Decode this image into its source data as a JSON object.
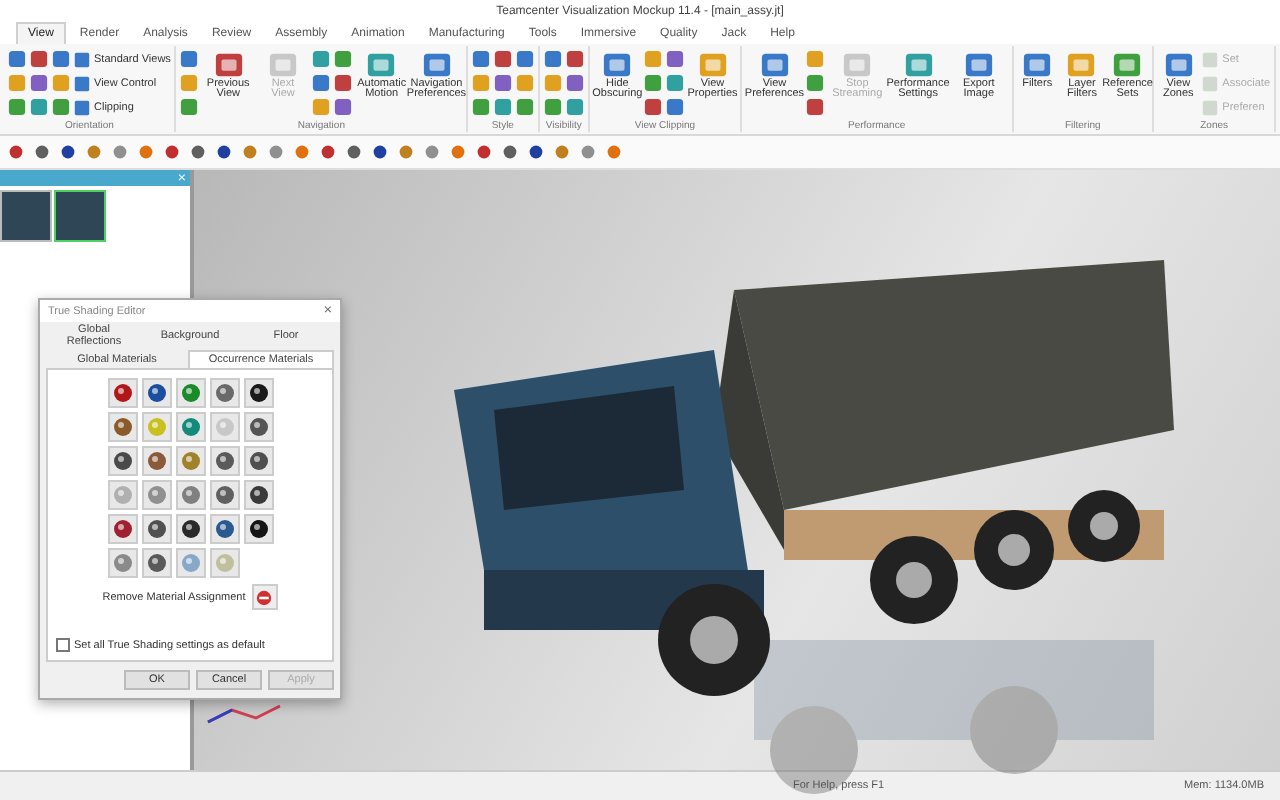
{
  "window": {
    "title": "Teamcenter Visualization Mockup 11.4 - [main_assy.jt]"
  },
  "tabs": [
    {
      "label": "View",
      "selected": true
    },
    {
      "label": "Render",
      "selected": false
    },
    {
      "label": "Analysis",
      "selected": false
    },
    {
      "label": "Review",
      "selected": false
    },
    {
      "label": "Assembly",
      "selected": false
    },
    {
      "label": "Animation",
      "selected": false
    },
    {
      "label": "Manufacturing",
      "selected": false
    },
    {
      "label": "Tools",
      "selected": false
    },
    {
      "label": "Immersive",
      "selected": false
    },
    {
      "label": "Quality",
      "selected": false
    },
    {
      "label": "Jack",
      "selected": false
    },
    {
      "label": "Help",
      "selected": false
    }
  ],
  "ribbon": {
    "groups": [
      {
        "label": "Orientation",
        "buttons": [
          {
            "kind": "icon",
            "disabled": false
          },
          {
            "kind": "icon",
            "disabled": false
          },
          {
            "kind": "icon",
            "disabled": false
          },
          {
            "kind": "icon",
            "disabled": false
          },
          {
            "kind": "icon",
            "disabled": false
          },
          {
            "kind": "icon",
            "disabled": false
          },
          {
            "kind": "icon",
            "disabled": false
          },
          {
            "kind": "icon",
            "disabled": false
          },
          {
            "kind": "icon",
            "disabled": false
          },
          {
            "kind": "small",
            "label": "Standard Views",
            "disabled": false
          },
          {
            "kind": "small",
            "label": "View Control",
            "disabled": false
          },
          {
            "kind": "small",
            "label": "Clipping",
            "disabled": false
          }
        ]
      },
      {
        "label": "Navigation",
        "buttons": [
          {
            "kind": "icon",
            "disabled": false
          },
          {
            "kind": "icon",
            "disabled": false
          },
          {
            "kind": "icon",
            "disabled": false
          },
          {
            "kind": "large",
            "label": "Previous View",
            "disabled": false
          },
          {
            "kind": "large",
            "label": "Next View",
            "disabled": true
          },
          {
            "kind": "icon",
            "disabled": false
          },
          {
            "kind": "icon",
            "disabled": false
          },
          {
            "kind": "icon",
            "disabled": false
          },
          {
            "kind": "icon",
            "disabled": false
          },
          {
            "kind": "icon",
            "disabled": false
          },
          {
            "kind": "icon",
            "disabled": false
          },
          {
            "kind": "large",
            "label": "Automatic Motion",
            "disabled": false
          },
          {
            "kind": "large",
            "label": "Navigation Preferences",
            "disabled": false
          }
        ]
      },
      {
        "label": "Style",
        "buttons": [
          {
            "kind": "icon",
            "disabled": false
          },
          {
            "kind": "icon",
            "disabled": false
          },
          {
            "kind": "icon",
            "disabled": false
          },
          {
            "kind": "icon",
            "disabled": false
          },
          {
            "kind": "icon",
            "disabled": false
          },
          {
            "kind": "icon",
            "disabled": false
          },
          {
            "kind": "icon",
            "disabled": false
          },
          {
            "kind": "icon",
            "disabled": false
          },
          {
            "kind": "icon",
            "disabled": false
          }
        ]
      },
      {
        "label": "Visibility",
        "buttons": [
          {
            "kind": "icon",
            "disabled": false
          },
          {
            "kind": "icon",
            "disabled": false
          },
          {
            "kind": "icon",
            "disabled": false
          },
          {
            "kind": "icon",
            "disabled": false
          },
          {
            "kind": "icon",
            "disabled": false
          },
          {
            "kind": "icon",
            "disabled": false
          }
        ]
      },
      {
        "label": "View Clipping",
        "buttons": [
          {
            "kind": "large",
            "label": "Hide Obscuring",
            "disabled": false
          },
          {
            "kind": "icon",
            "disabled": false
          },
          {
            "kind": "icon",
            "disabled": false
          },
          {
            "kind": "icon",
            "disabled": false
          },
          {
            "kind": "icon",
            "disabled": false
          },
          {
            "kind": "icon",
            "disabled": false
          },
          {
            "kind": "icon",
            "disabled": false
          },
          {
            "kind": "large",
            "label": "View Properties",
            "disabled": false
          }
        ]
      },
      {
        "label": "Performance",
        "buttons": [
          {
            "kind": "large",
            "label": "View Preferences",
            "disabled": false
          },
          {
            "kind": "icon",
            "disabled": false
          },
          {
            "kind": "icon",
            "disabled": false
          },
          {
            "kind": "icon",
            "disabled": false
          },
          {
            "kind": "large",
            "label": "Stop Streaming",
            "disabled": true
          },
          {
            "kind": "large",
            "label": "Performance Settings",
            "disabled": false
          },
          {
            "kind": "large",
            "label": "Export Image",
            "disabled": false
          }
        ]
      },
      {
        "label": "Filtering",
        "buttons": [
          {
            "kind": "large",
            "label": "Filters",
            "disabled": false
          },
          {
            "kind": "large",
            "label": "Layer Filters",
            "disabled": false
          },
          {
            "kind": "large",
            "label": "Reference Sets",
            "disabled": false
          }
        ]
      },
      {
        "label": "Zones",
        "buttons": [
          {
            "kind": "large",
            "label": "View Zones",
            "disabled": false
          },
          {
            "kind": "small",
            "label": "Set",
            "disabled": true
          },
          {
            "kind": "small",
            "label": "Associate",
            "disabled": true
          },
          {
            "kind": "small",
            "label": "Preferen",
            "disabled": true
          }
        ]
      }
    ]
  },
  "panel": {
    "close_glyph": "×",
    "thumbnails": [
      {
        "selected": false
      },
      {
        "selected": true
      }
    ]
  },
  "dialog": {
    "title": "True Shading Editor",
    "close_glyph": "×",
    "tab_rows": [
      [
        {
          "label": "Global Reflections",
          "selected": false
        },
        {
          "label": "Background",
          "selected": false
        },
        {
          "label": "Floor",
          "selected": false
        }
      ],
      [
        {
          "label": "Global Materials",
          "selected": false
        },
        {
          "label": "Occurrence Materials",
          "selected": true
        }
      ]
    ],
    "materials": [
      {
        "color": "#b01818"
      },
      {
        "color": "#1a4fa0"
      },
      {
        "color": "#1a8a2a"
      },
      {
        "color": "#6a6a6a"
      },
      {
        "color": "#1a1a1a"
      },
      {
        "color": "#8a5a2a"
      },
      {
        "color": "#c8c020"
      },
      {
        "color": "#138a7a"
      },
      {
        "color": "#c8c8c8"
      },
      {
        "color": "#555555"
      },
      {
        "color": "#4a4a4a"
      },
      {
        "color": "#8a5a3a"
      },
      {
        "color": "#a0822a"
      },
      {
        "color": "#5a5a5a"
      },
      {
        "color": "#505050"
      },
      {
        "color": "#b0b0b0"
      },
      {
        "color": "#909090"
      },
      {
        "color": "#808080"
      },
      {
        "color": "#606060"
      },
      {
        "color": "#3a3a3a"
      },
      {
        "color": "#a02030"
      },
      {
        "color": "#505050"
      },
      {
        "color": "#2a2a2a"
      },
      {
        "color": "#2a5a90"
      },
      {
        "color": "#151515"
      },
      {
        "color": "#8a8a8a"
      },
      {
        "color": "#5a5a5a"
      },
      {
        "color": "#88a8c8"
      },
      {
        "color": "#c0c0a0"
      }
    ],
    "remove_label": "Remove Material Assignment",
    "default_checkbox": {
      "label": "Set all True Shading settings as default",
      "checked": false
    },
    "buttons": [
      {
        "label": "OK",
        "disabled": false
      },
      {
        "label": "Cancel",
        "disabled": false
      },
      {
        "label": "Apply",
        "disabled": true
      }
    ]
  },
  "status_bar": {
    "help": "For Help, press F1",
    "memory": "Mem: 1134.0MB"
  }
}
